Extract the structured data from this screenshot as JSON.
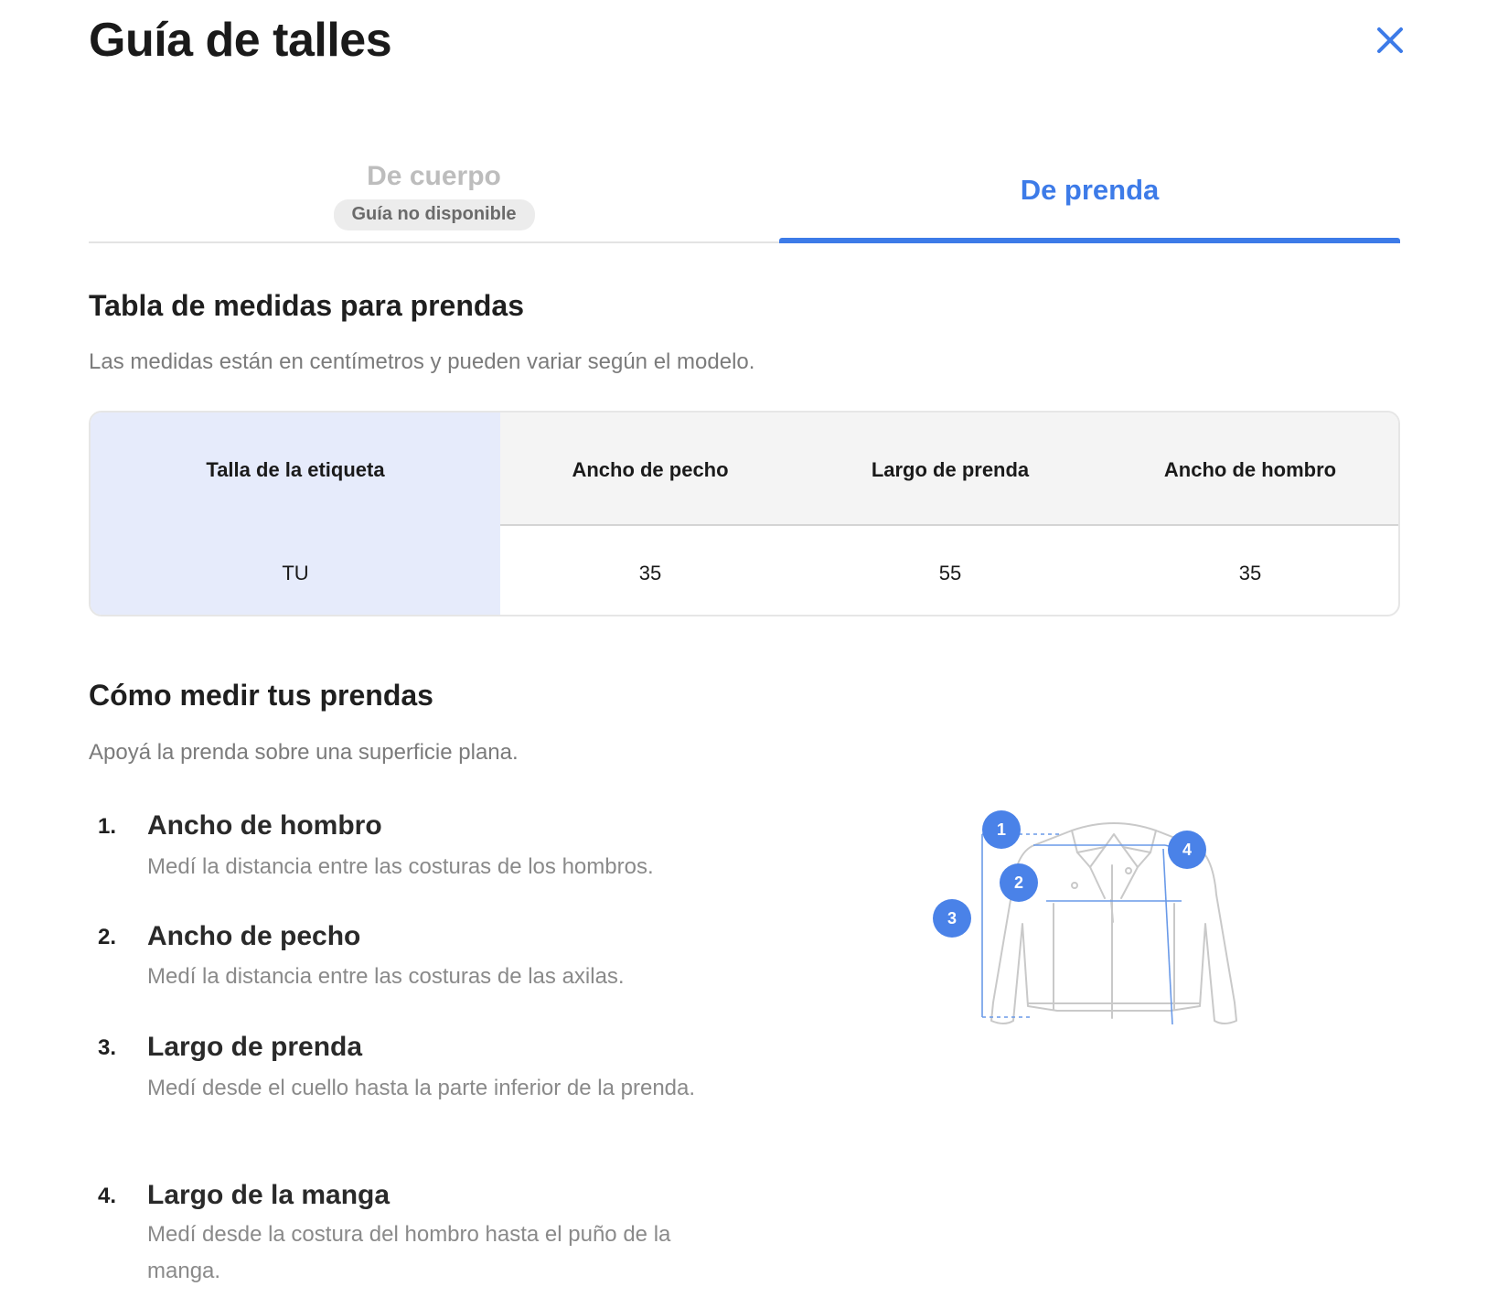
{
  "header": {
    "title": "Guía de talles",
    "close_icon": "close-icon"
  },
  "tabs": [
    {
      "label": "De cuerpo",
      "badge": "Guía no disponible",
      "active": false
    },
    {
      "label": "De prenda",
      "active": true
    }
  ],
  "colors": {
    "accent": "#3d7be8",
    "label_column_bg": "#e6ebfb",
    "header_bg": "#f4f4f4",
    "muted_text": "#7b7b7b",
    "disabled_tab": "#bdbdbd"
  },
  "measurements": {
    "title": "Tabla de medidas para prendas",
    "subtitle": "Las medidas están en centímetros y pueden variar según el modelo.",
    "table": {
      "label_header": "Talla de la etiqueta",
      "columns": [
        "Ancho de pecho",
        "Largo de prenda",
        "Ancho de hombro"
      ],
      "rows": [
        {
          "label": "TU",
          "values": [
            "35",
            "55",
            "35"
          ]
        }
      ]
    }
  },
  "how_to": {
    "title": "Cómo medir tus prendas",
    "subtitle": "Apoyá la prenda sobre una superficie plana.",
    "steps": [
      {
        "num": "1.",
        "title": "Ancho de hombro",
        "desc": "Medí la distancia entre las costuras de los hombros."
      },
      {
        "num": "2.",
        "title": "Ancho de pecho",
        "desc": "Medí la distancia entre las costuras de las axilas."
      },
      {
        "num": "3.",
        "title": "Largo de prenda",
        "desc": "Medí desde el cuello hasta la parte inferior de la prenda."
      },
      {
        "num": "4.",
        "title": "Largo de la manga",
        "desc": "Medí desde la costura del hombro hasta el puño de la manga."
      }
    ],
    "diagram": {
      "icon": "jacket-illustration",
      "markers": [
        "1",
        "2",
        "3",
        "4"
      ]
    }
  }
}
